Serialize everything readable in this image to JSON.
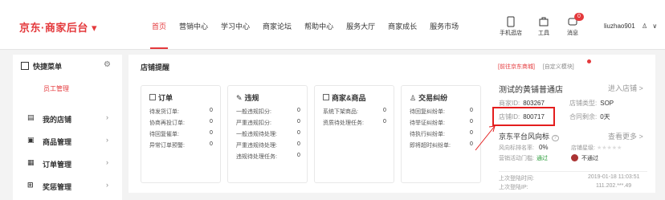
{
  "header": {
    "logo": "京东·商家后台 ▾",
    "nav": [
      "首页",
      "营销中心",
      "学习中心",
      "商家论坛",
      "帮助中心",
      "服务大厅",
      "商家成长",
      "服务市场"
    ],
    "tools": {
      "shop": "手机逛店",
      "tools": "工具",
      "msg": "消息",
      "msg_badge": "0"
    },
    "user": "liuzhao901"
  },
  "sidebar": {
    "title": "快捷菜单",
    "sub": "员工管理",
    "items": [
      {
        "label": "我的店铺"
      },
      {
        "label": "商品管理"
      },
      {
        "label": "订单管理"
      },
      {
        "label": "奖惩管理"
      }
    ]
  },
  "main": {
    "title": "店铺提醒",
    "cards": [
      {
        "title": "订单",
        "rows": [
          [
            "待发货订单:",
            "0"
          ],
          [
            "协商再投订单:",
            "0"
          ],
          [
            "待回复催单:",
            "0"
          ],
          [
            "异常订单预警:",
            "0"
          ]
        ]
      },
      {
        "title": "违规",
        "rows": [
          [
            "一般违规扣分:",
            "0"
          ],
          [
            "严重违规扣分:",
            "0"
          ],
          [
            "一般违规待处理:",
            "0"
          ],
          [
            "严重违规待处理:",
            "0"
          ],
          [
            "违规待处理任务:",
            "0"
          ]
        ]
      },
      {
        "title": "商家&商品",
        "rows": [
          [
            "系统下架商品:",
            "0"
          ],
          [
            "资质待处理任务:",
            "0"
          ]
        ]
      },
      {
        "title": "交易纠纷",
        "rows": [
          [
            "待回复纠纷单:",
            "0"
          ],
          [
            "待举证纠纷单:",
            "0"
          ],
          [
            "待执行纠纷单:",
            "0"
          ],
          [
            "即将超时纠纷单:",
            "0"
          ]
        ]
      }
    ]
  },
  "right": {
    "link1": "[前往京东商城]",
    "link2": "[自定义模块]",
    "store_name": "测试的黄铺普通店",
    "enter": "进入店铺 >",
    "merchant_id_k": "商家ID:",
    "merchant_id_v": "803267",
    "store_type_k": "店铺类型:",
    "store_type_v": "SOP",
    "store_id_k": "店铺ID:",
    "store_id_v": "800717",
    "contract_k": "合同剩余:",
    "contract_v": "0天",
    "feng": "京东平台风向标",
    "more": "查看更多 >",
    "rank_k": "风向标排名率:",
    "rank_v": "0%",
    "level_k": "店铺星级:",
    "activity_k": "营销活动门槛:",
    "activity_v": "通过",
    "activity_v2": "不通过",
    "last_time_k": "上次登陆时间:",
    "last_time_v": "2019-01-18 11:03:51",
    "last_ip_k": "上次登陆IP:",
    "last_ip_v": "111.202.***.49"
  }
}
